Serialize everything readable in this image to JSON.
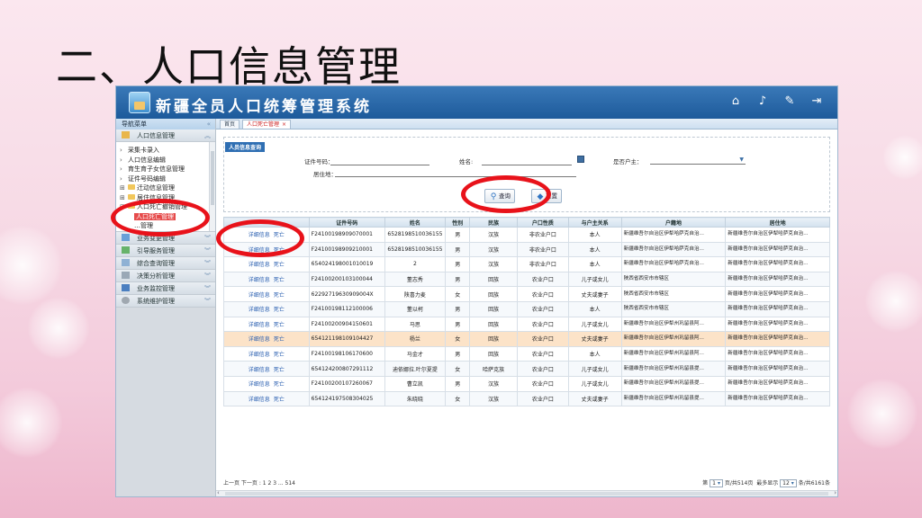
{
  "slide_title": "二、人口信息管理",
  "app": {
    "title": "新疆全员人口统筹管理系统",
    "header_icons": [
      "home-icon",
      "bell-icon",
      "wrench-icon",
      "logout-icon"
    ]
  },
  "nav": {
    "title": "导航菜单",
    "top_group": "人口信息管理",
    "tree": [
      {
        "label": "采集卡录入",
        "type": "leaf"
      },
      {
        "label": "人口信息编辑",
        "type": "leaf"
      },
      {
        "label": "育生育子女信息管理",
        "type": "leaf"
      },
      {
        "label": "证件号码编辑",
        "type": "leaf"
      },
      {
        "label": "迁动信息管理",
        "type": "folder"
      },
      {
        "label": "居住信息管理",
        "type": "folder"
      },
      {
        "label": "人口死亡撤销管理",
        "type": "folder-open"
      },
      {
        "label": "人口死亡管理",
        "type": "active"
      },
      {
        "label": "…管理",
        "type": "leaf"
      }
    ],
    "groups": [
      "业务变更管理",
      "引导服务管理",
      "综合查询管理",
      "决策分析管理",
      "业务监控管理",
      "系统维护管理"
    ]
  },
  "tabs": [
    {
      "label": "首页"
    },
    {
      "label": "人口死亡管理"
    }
  ],
  "form": {
    "legend": "人员信息查询",
    "id_label": "证件号码：",
    "name_label": "姓名:",
    "residence_label": "居住地：",
    "householder_label": "是否户主：",
    "search_button": "查询",
    "reset_button": "重置"
  },
  "table": {
    "headers": [
      "",
      "证件号码",
      "姓名",
      "性别",
      "民族",
      "户口性质",
      "与户主关系",
      "户籍地",
      "居住地"
    ],
    "op_detail": "详细信息",
    "op_death": "死亡",
    "rows": [
      {
        "id": "F24100198909070001",
        "name": "6528198510036155",
        "sex": "男",
        "ethnic": "汉族",
        "hukou": "非农业户口",
        "relation": "本人",
        "reg": "新疆维吾尔自治区伊犁哈萨克自治...",
        "res": "新疆维吾尔自治区伊犁哈萨克自治..."
      },
      {
        "id": "F24100198909210001",
        "name": "6528198510036155",
        "sex": "男",
        "ethnic": "汉族",
        "hukou": "非农业户口",
        "relation": "本人",
        "reg": "新疆维吾尔自治区伊犁哈萨克自治...",
        "res": "新疆维吾尔自治区伊犁哈萨克自治..."
      },
      {
        "id": "654024198001010019",
        "name": "2",
        "sex": "男",
        "ethnic": "汉族",
        "hukou": "非农业户口",
        "relation": "本人",
        "reg": "新疆维吾尔自治区伊犁哈萨克自治...",
        "res": "新疆维吾尔自治区伊犁哈萨克自治..."
      },
      {
        "id": "F24100200103100044",
        "name": "董志秀",
        "sex": "男",
        "ethnic": "回族",
        "hukou": "农业户口",
        "relation": "儿子或女儿",
        "reg": "陕西省西安市市辖区",
        "res": "新疆维吾尔自治区伊犁哈萨克自治..."
      },
      {
        "id": "62292719630909004X",
        "name": "陕喜力麦",
        "sex": "女",
        "ethnic": "回族",
        "hukou": "农业户口",
        "relation": "丈夫或妻子",
        "reg": "陕西省西安市市辖区",
        "res": "新疆维吾尔自治区伊犁哈萨克自治..."
      },
      {
        "id": "F24100198112100006",
        "name": "董以柯",
        "sex": "男",
        "ethnic": "回族",
        "hukou": "农业户口",
        "relation": "本人",
        "reg": "陕西省西安市市辖区",
        "res": "新疆维吾尔自治区伊犁哈萨克自治..."
      },
      {
        "id": "F24100200904150601",
        "name": "马思",
        "sex": "男",
        "ethnic": "回族",
        "hukou": "农业户口",
        "relation": "儿子或女儿",
        "reg": "新疆维吾尔自治区伊犁州巩留县阿...",
        "res": "新疆维吾尔自治区伊犁哈萨克自治..."
      },
      {
        "id": "654121198109104427",
        "name": "杨兰",
        "sex": "女",
        "ethnic": "回族",
        "hukou": "农业户口",
        "relation": "丈夫或妻子",
        "reg": "新疆维吾尔自治区伊犁州巩留县阿...",
        "res": "新疆维吾尔自治区伊犁哈萨克自治..."
      },
      {
        "id": "F24100198106170600",
        "name": "马金才",
        "sex": "男",
        "ethnic": "回族",
        "hukou": "农业户口",
        "relation": "本人",
        "reg": "新疆维吾尔自治区伊犁州巩留县阿...",
        "res": "新疆维吾尔自治区伊犁哈萨克自治..."
      },
      {
        "id": "654124200807291112",
        "name": "迪依娜拉.叶尔夏提",
        "sex": "女",
        "ethnic": "哈萨克族",
        "hukou": "农业户口",
        "relation": "儿子或女儿",
        "reg": "新疆维吾尔自治区伊犁州巩留县提...",
        "res": "新疆维吾尔自治区伊犁哈萨克自治..."
      },
      {
        "id": "F24100200107260067",
        "name": "曹立凯",
        "sex": "男",
        "ethnic": "汉族",
        "hukou": "农业户口",
        "relation": "儿子或女儿",
        "reg": "新疆维吾尔自治区伊犁州巩留县提...",
        "res": "新疆维吾尔自治区伊犁哈萨克自治..."
      },
      {
        "id": "654124197508304025",
        "name": "朱晓晓",
        "sex": "女",
        "ethnic": "汉族",
        "hukou": "农业户口",
        "relation": "丈夫或妻子",
        "reg": "新疆维吾尔自治区伊犁州巩留县提...",
        "res": "新疆维吾尔自治区伊犁哈萨克自治..."
      }
    ],
    "highlight_row": 7
  },
  "pager": {
    "left": "上一页 下一页 : 1 2 3 ... 514",
    "page_prefix": "第",
    "page_value": "1",
    "page_suffix": "页/共514页",
    "show_prefix": "最多显示",
    "show_value": "12",
    "show_suffix": "条/共6161条"
  }
}
